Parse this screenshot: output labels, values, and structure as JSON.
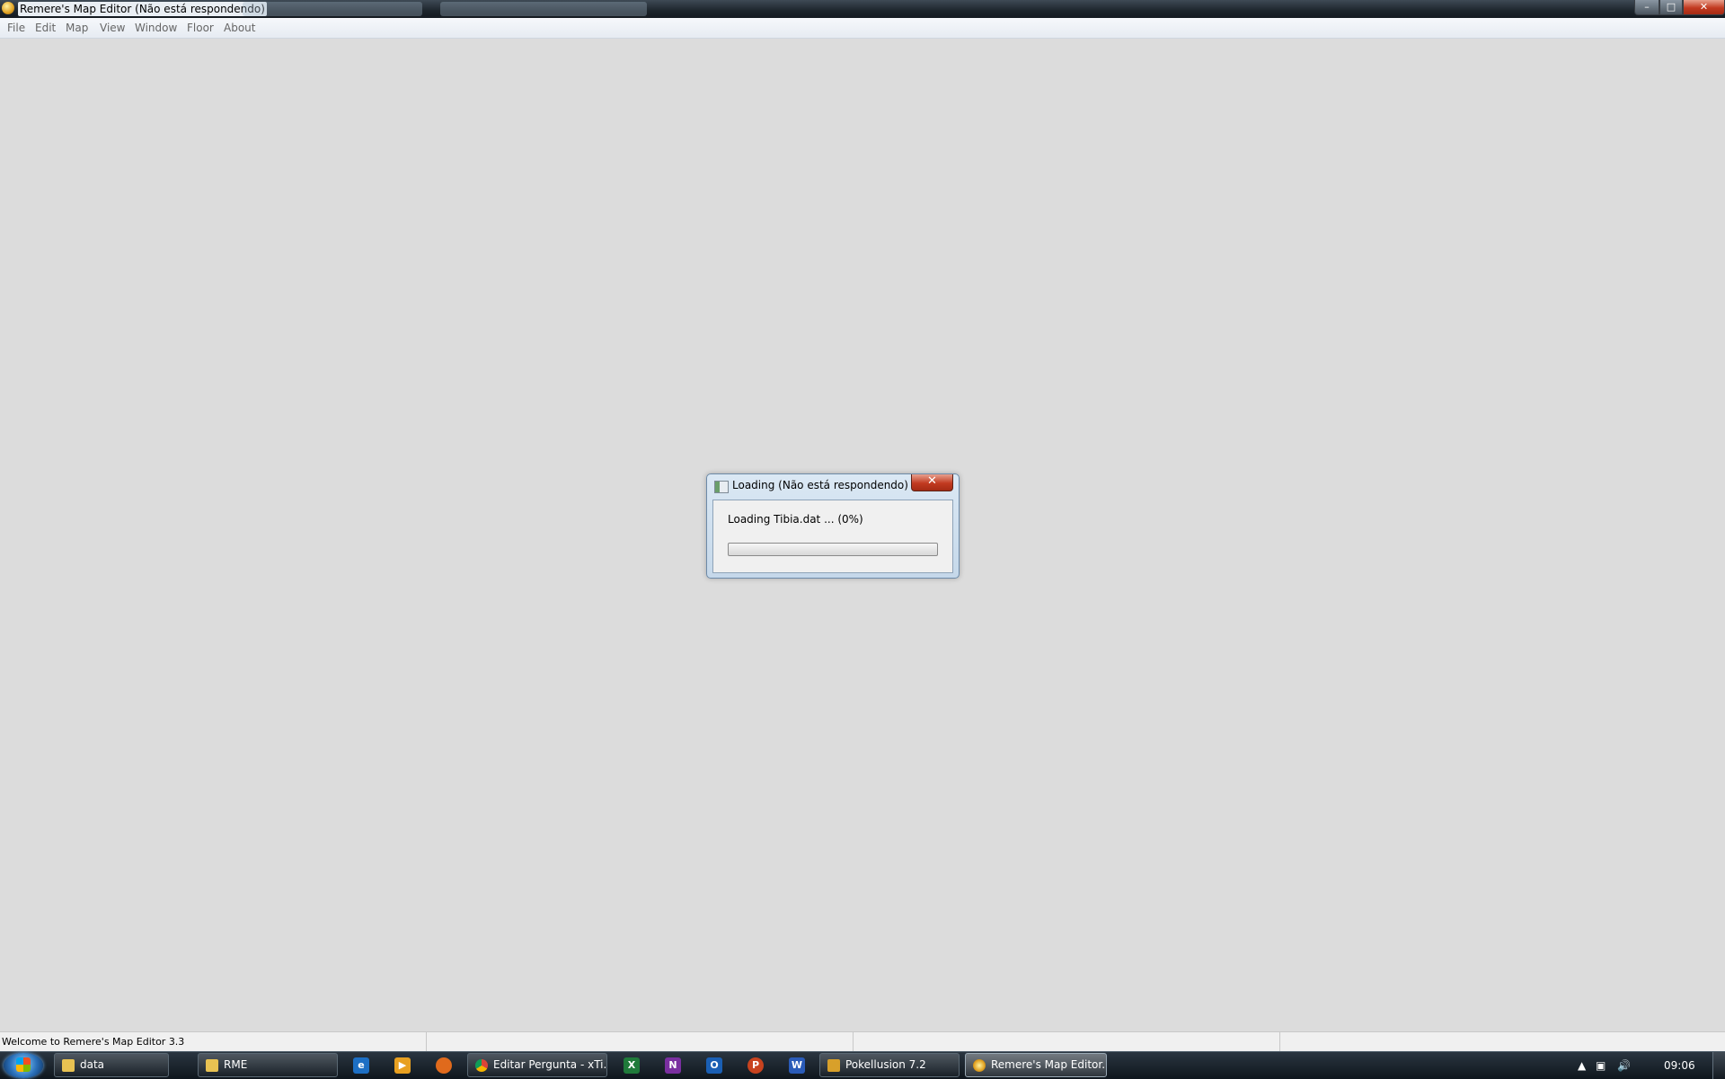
{
  "window": {
    "title": "Remere's Map Editor (Não está respondendo)",
    "controls": {
      "minimize_icon": "minimize-icon",
      "maximize_icon": "maximize-icon",
      "close_icon": "close-icon"
    }
  },
  "menu": {
    "items": [
      {
        "label": "File"
      },
      {
        "label": "Edit"
      },
      {
        "label": "Map"
      },
      {
        "label": "View"
      },
      {
        "label": "Window"
      },
      {
        "label": "Floor"
      },
      {
        "label": "About"
      }
    ]
  },
  "dialog": {
    "title": "Loading (Não está respondendo)",
    "close_glyph": "✕",
    "message": "Loading Tibia.dat ... (0%)",
    "progress": 0
  },
  "statusbar": {
    "text": "Welcome to Remere's Map Editor 3.3"
  },
  "taskbar": {
    "buttons": [
      {
        "label": "data",
        "icon": "folder-icon"
      },
      {
        "label": "RME",
        "icon": "folder-icon"
      },
      {
        "label": "Editar Pergunta - xTi...",
        "icon": "chrome-icon"
      },
      {
        "label": "Pokellusion 7.2",
        "icon": "game-icon"
      },
      {
        "label": "Remere's Map Editor...",
        "icon": "rme-icon"
      }
    ],
    "pinned": [
      {
        "icon": "internet-explorer-icon"
      },
      {
        "icon": "media-player-icon"
      },
      {
        "icon": "firefox-icon"
      },
      {
        "icon": "excel-icon",
        "glyph": "X"
      },
      {
        "icon": "onenote-icon",
        "glyph": "N"
      },
      {
        "icon": "outlook-icon",
        "glyph": "O"
      },
      {
        "icon": "powerpoint-icon",
        "glyph": "P"
      },
      {
        "icon": "word-icon",
        "glyph": "W"
      }
    ],
    "clock": "09:06"
  },
  "colors": {
    "workspace": "#dcdcdc",
    "progress_fill": "#3fa81e",
    "close_red": "#c23a20"
  }
}
